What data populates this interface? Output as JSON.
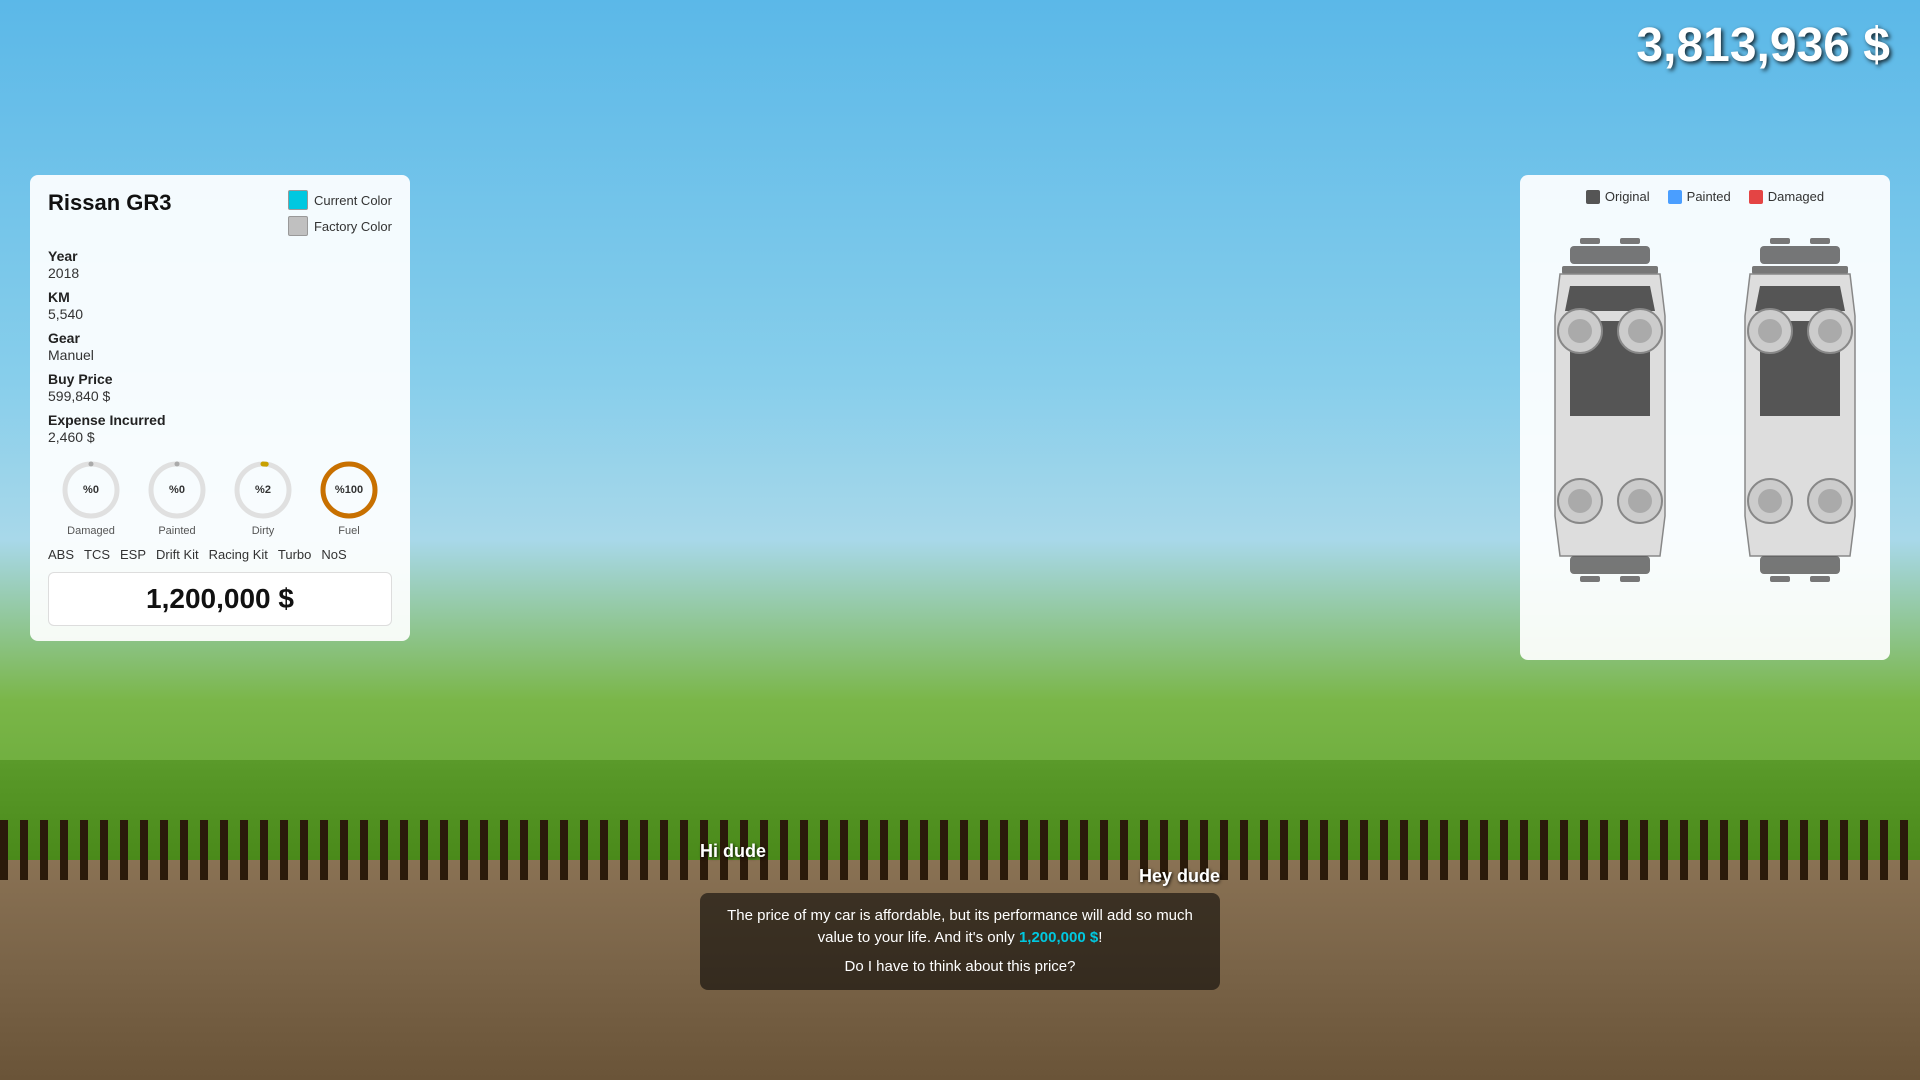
{
  "hud": {
    "money": "3,813,936 $"
  },
  "car_panel": {
    "title": "Rissan GR3",
    "current_color_label": "Current Color",
    "factory_color_label": "Factory Color",
    "year_label": "Year",
    "year_value": "2018",
    "km_label": "KM",
    "km_value": "5,540",
    "gear_label": "Gear",
    "gear_value": "Manuel",
    "buy_price_label": "Buy Price",
    "buy_price_value": "599,840 $",
    "expense_label": "Expense Incurred",
    "expense_value": "2,460 $",
    "gauges": [
      {
        "id": "damaged",
        "label": "Damaged",
        "value": "0",
        "display": "%0",
        "color": "#aaa",
        "percent": 0
      },
      {
        "id": "painted",
        "label": "Painted",
        "value": "0",
        "display": "%0",
        "color": "#aaa",
        "percent": 0
      },
      {
        "id": "dirty",
        "label": "Dirty",
        "value": "2",
        "display": "%2",
        "color": "#c8a000",
        "percent": 2
      },
      {
        "id": "fuel",
        "label": "Fuel",
        "value": "100",
        "display": "%100",
        "color": "#c87000",
        "percent": 100
      }
    ],
    "mods": [
      "ABS",
      "TCS",
      "ESP",
      "Drift Kit",
      "Racing Kit",
      "Turbo",
      "NoS"
    ],
    "sale_price": "1,200,000 $"
  },
  "diagram_panel": {
    "legend": [
      {
        "id": "original",
        "label": "Original",
        "color": "#555"
      },
      {
        "id": "painted",
        "label": "Painted",
        "color": "#4a9eff"
      },
      {
        "id": "damaged",
        "label": "Damaged",
        "color": "#e44444"
      }
    ]
  },
  "dialogue": {
    "greeting_left": "Hi dude",
    "greeting_right": "Hey dude",
    "message": "The price of my car is affordable, but its performance will add so much value to your life. And it's only 1,200,000 $!",
    "highlight": "1,200,000 $",
    "question": "Do I have to think about this price?"
  }
}
